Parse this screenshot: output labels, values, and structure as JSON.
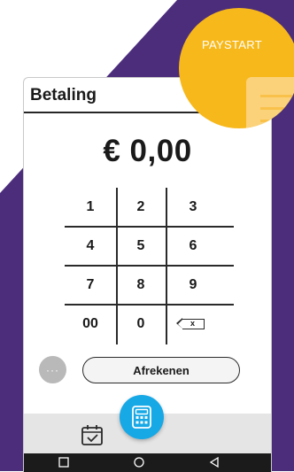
{
  "header": {
    "title": "Betaling"
  },
  "amount": {
    "display": "€ 0,00"
  },
  "keypad": {
    "keys": [
      "1",
      "2",
      "3",
      "4",
      "5",
      "6",
      "7",
      "8",
      "9",
      "00",
      "0"
    ],
    "backspace_label": "x"
  },
  "actions": {
    "more_label": "···",
    "checkout_label": "Afrekenen"
  },
  "badge": {
    "label": "PAYSTART"
  },
  "icons": {
    "calendar": "calendar-check-icon",
    "calculator": "calculator-icon",
    "nav_recent": "square-icon",
    "nav_home": "circle-icon",
    "nav_back": "triangle-back-icon"
  },
  "colors": {
    "background_purple": "#4c2d7c",
    "fab_blue": "#17a8e6",
    "badge_yellow": "#f7b81b",
    "bottom_bar": "#e5e5e5",
    "nav_bar": "#1b1b1b"
  }
}
